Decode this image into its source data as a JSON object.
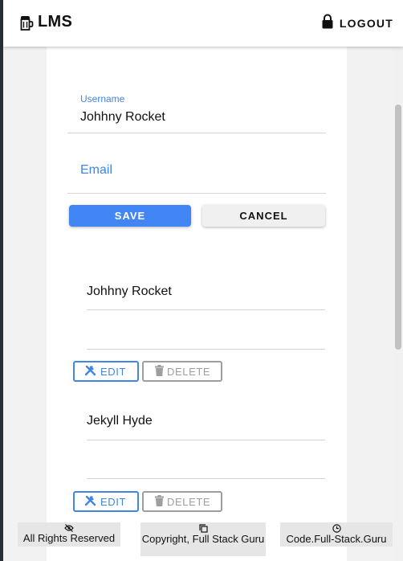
{
  "appbar": {
    "title": "LMS",
    "logout_label": "LOGOUT"
  },
  "form": {
    "username_label": "Username",
    "username_value": "Johhny Rocket",
    "email_placeholder": "Email",
    "save_label": "SAVE",
    "cancel_label": "CANCEL"
  },
  "users": [
    {
      "name": "Johhny Rocket",
      "edit_label": "EDIT",
      "delete_label": "DELETE"
    },
    {
      "name": "Jekyll Hyde",
      "edit_label": "EDIT",
      "delete_label": "DELETE"
    }
  ],
  "footer": {
    "rights": "All Rights Reserved",
    "copyright": "Copyright, Full Stack Guru",
    "site": "Code.Full-Stack.Guru"
  },
  "colors": {
    "primary": "#4285f4",
    "label_blue": "#3f86e6",
    "disabled_gray": "#9e9e9e"
  },
  "icons": {
    "brand": "beer-mug-icon",
    "logout": "lock-icon",
    "edit": "tools-icon",
    "delete": "trash-icon",
    "rights": "eye-off-icon",
    "copyright": "copy-icon",
    "site": "clock-icon"
  }
}
